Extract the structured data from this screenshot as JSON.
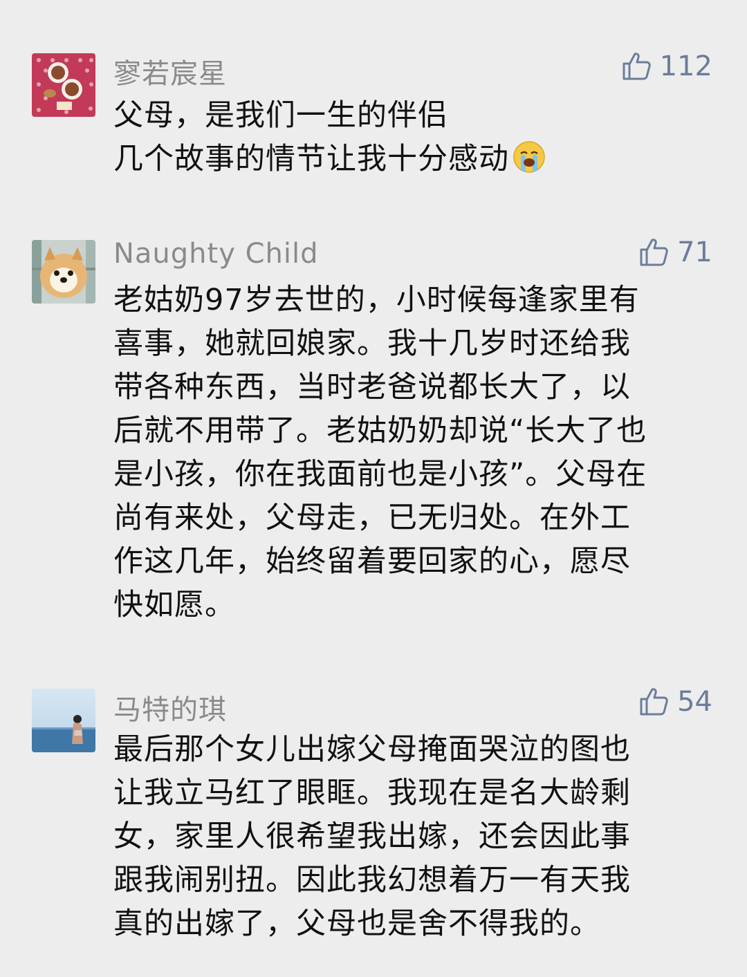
{
  "comments": [
    {
      "nickname": "寥若宸星",
      "likes": "112",
      "avatar_icon": "coffee-cups-avatar",
      "lines": [
        "父母，是我们一生的伴侣",
        "几个故事的情节让我十分感动"
      ],
      "emoji": "crying-face-emoji"
    },
    {
      "nickname": "Naughty Child",
      "likes": "71",
      "avatar_icon": "pomeranian-dog-avatar",
      "lines": [
        "老姑奶97岁去世的，小时候每逢家里有",
        "喜事，她就回娘家。我十几岁时还给我",
        "带各种东西，当时老爸说都长大了，以",
        "后就不用带了。老姑奶奶却说“长大了也",
        "是小孩，你在我面前也是小孩”。父母在",
        "尚有来处，父母走，已无归处。在外工",
        "作这几年，始终留着要回家的心，愿尽",
        "快如愿。"
      ]
    },
    {
      "nickname": "马特的琪",
      "likes": "54",
      "avatar_icon": "seaside-girl-avatar",
      "lines": [
        "最后那个女儿出嫁父母掩面哭泣的图也",
        "让我立马红了眼眶。我现在是名大龄剩",
        "女，家里人很希望我出嫁，还会因此事",
        "跟我闹别扭。因此我幻想着万一有天我",
        "真的出嫁了，父母也是舍不得我的。"
      ]
    }
  ],
  "colors": {
    "background": "#ededed",
    "nickname": "#8a8a8a",
    "like": "#6b7d9a",
    "text": "#111111"
  }
}
